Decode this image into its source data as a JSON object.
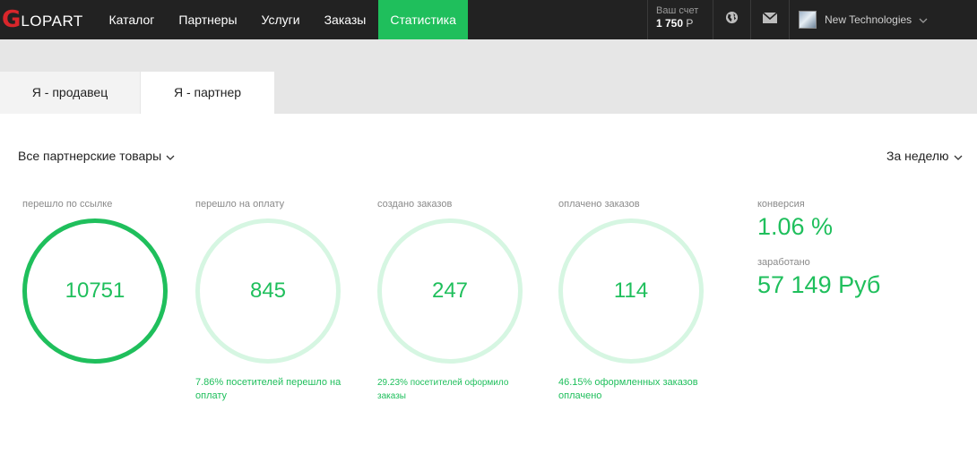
{
  "header": {
    "logo_initial": "G",
    "logo_rest": "LOPART",
    "nav": [
      {
        "label": "Каталог"
      },
      {
        "label": "Партнеры"
      },
      {
        "label": "Услуги"
      },
      {
        "label": "Заказы"
      },
      {
        "label": "Статистика",
        "active": true
      }
    ],
    "account": {
      "label": "Ваш счет",
      "amount": "1 750",
      "currency": "Р"
    },
    "icons": [
      "globe-icon",
      "mail-icon"
    ],
    "user_name": "New Technologies"
  },
  "tabs": [
    {
      "label": "Я - продавец",
      "active": false
    },
    {
      "label": "Я - партнер",
      "active": true
    }
  ],
  "filters": {
    "products": "Все партнерские товары",
    "period": "За неделю"
  },
  "stats": [
    {
      "label": "перешло по ссылке",
      "value": "10751",
      "note": ""
    },
    {
      "label": "перешло на оплату",
      "value": "845",
      "note": "7.86% посетителей перешло на оплату"
    },
    {
      "label": "создано заказов",
      "value": "247",
      "note": "29.23% посетителей оформило заказы"
    },
    {
      "label": "оплачено заказов",
      "value": "114",
      "note": "46.15% оформленных заказов оплачено"
    }
  ],
  "summary": {
    "conversion_label": "конверсия",
    "conversion_value": "1.06 %",
    "earned_label": "заработано",
    "earned_value": "57 149 Руб"
  },
  "colors": {
    "accent": "#1fbf5c",
    "accent_light": "#d6f6e2",
    "topbar": "#222222",
    "logo_red": "#d9262b"
  }
}
